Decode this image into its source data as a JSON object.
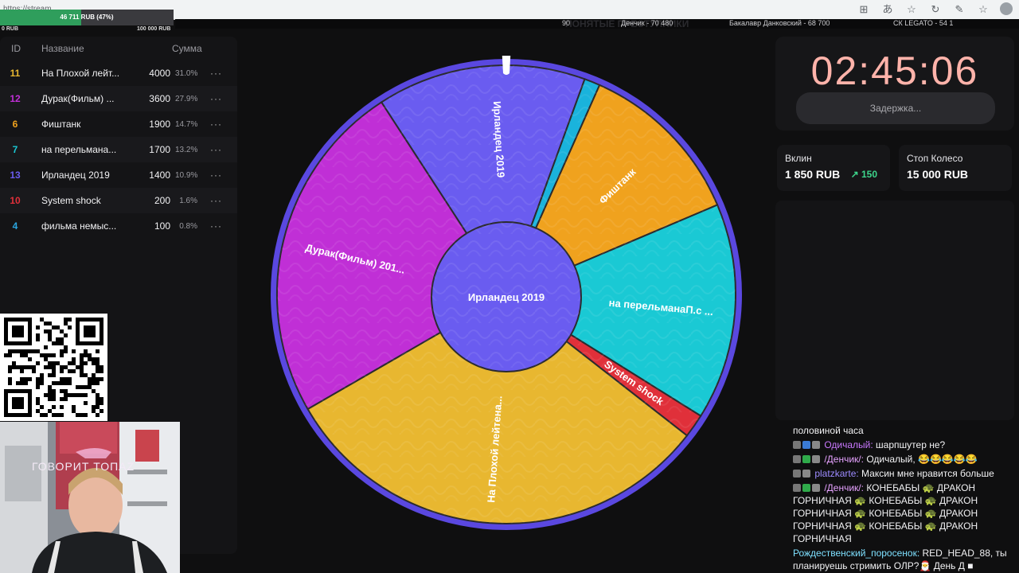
{
  "browser": {
    "url": "https://stream...",
    "tab_title": "ПОНЯТЫЕ ПРЕСТУПНИКИ"
  },
  "goal": {
    "label": "46 711 RUB (47%)",
    "progress_fraction": 0.47,
    "min": "0 RUB",
    "max": "100 000 RUB"
  },
  "ticker": {
    "items": [
      "90",
      "Денчик - 70 480",
      "Бакалавр Данковский - 68 700",
      "СК LEGATO - 54 1"
    ]
  },
  "lots": {
    "headers": {
      "id": "ID",
      "name": "Название",
      "sum": "Сумма"
    },
    "rows": [
      {
        "id": "11",
        "name": "На Плохой лейт...",
        "amount": "4000",
        "pct": "31.0%",
        "id_color": "#e8b730"
      },
      {
        "id": "12",
        "name": "Дурак(Фильм) ...",
        "amount": "3600",
        "pct": "27.9%",
        "id_color": "#c02fd6"
      },
      {
        "id": "6",
        "name": "Фиштанк",
        "amount": "1900",
        "pct": "14.7%",
        "id_color": "#f0a21e"
      },
      {
        "id": "7",
        "name": "на перельмана...",
        "amount": "1700",
        "pct": "13.2%",
        "id_color": "#1ac9d4"
      },
      {
        "id": "13",
        "name": "Ирландец 2019",
        "amount": "1400",
        "pct": "10.9%",
        "id_color": "#6a5cf0"
      },
      {
        "id": "10",
        "name": "System shock",
        "amount": "200",
        "pct": "1.6%",
        "id_color": "#e0303a"
      },
      {
        "id": "4",
        "name": "фильма немыс...",
        "amount": "100",
        "pct": "0.8%",
        "id_color": "#2aa6e0"
      }
    ],
    "menu_glyph": "···"
  },
  "webcam": {
    "overlay_text": "ГОВОРИТ ТОПАZ"
  },
  "wheel": {
    "center_label": "Ирландец 2019",
    "slices": [
      {
        "label": "Ирландец 2019",
        "color": "#6a5cf0"
      },
      {
        "label": "",
        "color": "#1ab3dc"
      },
      {
        "label": "Фиштанк",
        "color": "#f0a21e"
      },
      {
        "label": "на перельманаП.с ...",
        "color": "#1ac9d4"
      },
      {
        "label": "System shock",
        "color": "#e0303a"
      },
      {
        "label": "На Плохой лейтена...",
        "color": "#e8b730"
      },
      {
        "label": "Дурак(Фильм) 201...",
        "color": "#c02fd6"
      }
    ],
    "rim_color": "#5a48e0"
  },
  "timer": {
    "value": "02:45:06",
    "delay_label": "Задержка..."
  },
  "stats": {
    "vklin": {
      "title": "Вклин",
      "value": "1 850 RUB",
      "delta": "150"
    },
    "stop": {
      "title": "Стоп Колесо",
      "value": "15 000 RUB"
    }
  },
  "chat": [
    {
      "user": "",
      "text": "половиной часа"
    },
    {
      "user": "Одичалый:",
      "text": " шарпшутер не?"
    },
    {
      "user": "/Денчик/:",
      "text": " Одичалый, 😂😂😂😂😂"
    },
    {
      "user": "platzkarte:",
      "text": " Максин мне нравится больше"
    },
    {
      "user": "/Денчик/:",
      "text": " КОНЕБАБЫ 🐢 ДРАКОН ГОРНИЧНАЯ 🐢 КОНЕБАБЫ 🐢 ДРАКОН ГОРНИЧНАЯ 🐢 КОНЕБАБЫ 🐢 ДРАКОН ГОРНИЧНАЯ 🐢 КОНЕБАБЫ 🐢 ДРАКОН ГОРНИЧНАЯ"
    },
    {
      "user": "Рождественский_поросенок:",
      "text": " RED_HEAD_88, ты планируешь стримить ОЛР?🎅 День Д ■"
    }
  ]
}
